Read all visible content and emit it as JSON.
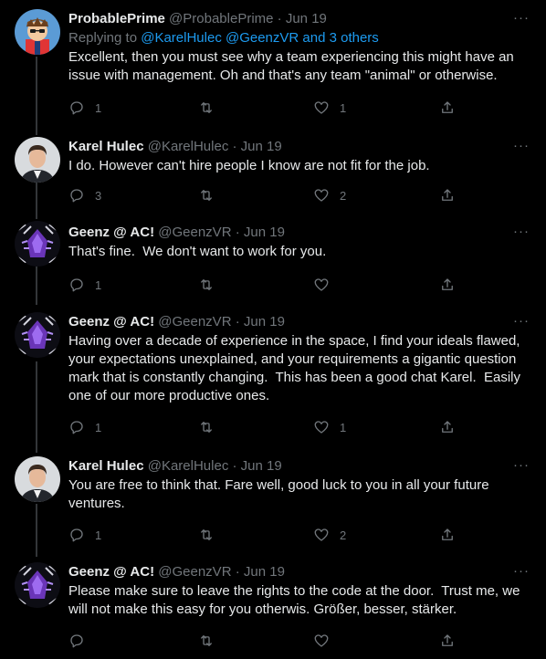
{
  "tweets": [
    {
      "display_name": "ProbablePrime",
      "handle": "@ProbablePrime",
      "date": "Jun 19",
      "reply_prefix": "Replying to ",
      "reply_mentions": "@KarelHulec @GeenzVR and 3 others",
      "text": "Excellent, then you must see why a team experiencing this might have an issue with management. Oh and that's any team \"animal\" or otherwise.",
      "reply_count": "1",
      "retweet_count": "",
      "like_count": "1"
    },
    {
      "display_name": "Karel Hulec",
      "handle": "@KarelHulec",
      "date": "Jun 19",
      "text": "I do. However can't hire people I know are not fit for the job.",
      "reply_count": "3",
      "retweet_count": "",
      "like_count": "2"
    },
    {
      "display_name": "Geenz @ AC!",
      "handle": "@GeenzVR",
      "date": "Jun 19",
      "text": "That's fine.  We don't want to work for you.",
      "reply_count": "1",
      "retweet_count": "",
      "like_count": ""
    },
    {
      "display_name": "Geenz @ AC!",
      "handle": "@GeenzVR",
      "date": "Jun 19",
      "text": "Having over a decade of experience in the space, I find your ideals flawed, your expectations unexplained, and your requirements a gigantic question mark that is constantly changing.  This has been a good chat Karel.  Easily one of our more productive ones.",
      "reply_count": "1",
      "retweet_count": "",
      "like_count": "1"
    },
    {
      "display_name": "Karel Hulec",
      "handle": "@KarelHulec",
      "date": "Jun 19",
      "text": "You are free to think that. Fare well, good luck to you in all your future ventures.",
      "reply_count": "1",
      "retweet_count": "",
      "like_count": "2"
    },
    {
      "display_name": "Geenz @ AC!",
      "handle": "@GeenzVR",
      "date": "Jun 19",
      "text": "Please make sure to leave the rights to the code at the door.  Trust me, we will not make this easy for you otherwis. Größer, besser, stärker.",
      "reply_count": "",
      "retweet_count": "",
      "like_count": ""
    }
  ],
  "separator": "·",
  "more_glyph": "···",
  "colors": {
    "background": "#000000",
    "text": "#e7e9ea",
    "muted": "#71767b",
    "link": "#1d9bf0",
    "thread_line": "#333639"
  }
}
